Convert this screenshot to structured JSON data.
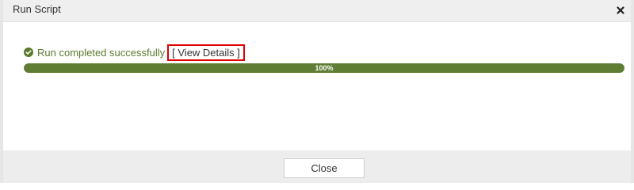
{
  "dialog": {
    "title": "Run Script",
    "close_icon": "close-x-icon"
  },
  "status": {
    "icon": "check-circle-icon",
    "text": "Run completed successfully",
    "details_link": "[ View Details ]",
    "color": "#5b7a2e"
  },
  "progress": {
    "value": 1.0,
    "label": "100%",
    "fill_color": "#5f7d33"
  },
  "footer": {
    "close_label": "Close"
  }
}
